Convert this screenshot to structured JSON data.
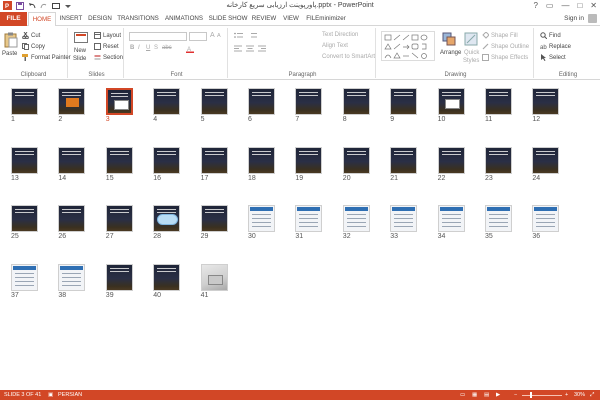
{
  "titlebar": {
    "title": "پاورپوینت ارزیابی سریع کارخانه.pptx - PowerPoint",
    "help": "?",
    "minimize": "—",
    "maximize": "□",
    "close": "✕"
  },
  "tabs": {
    "file": "FILE",
    "items": [
      "HOME",
      "INSERT",
      "DESIGN",
      "TRANSITIONS",
      "ANIMATIONS",
      "SLIDE SHOW",
      "REVIEW",
      "VIEW",
      "FILEminimizer"
    ],
    "active": "HOME",
    "signin": "Sign in"
  },
  "ribbon": {
    "clipboard": {
      "label": "Clipboard",
      "paste": "Paste",
      "cut": "Cut",
      "copy": "Copy",
      "format_painter": "Format Painter"
    },
    "slides": {
      "label": "Slides",
      "new_slide": "New",
      "new_slide2": "Slide",
      "layout": "Layout",
      "reset": "Reset",
      "section": "Section"
    },
    "font": {
      "label": "Font",
      "bold": "B",
      "italic": "I",
      "underline": "U",
      "shadow": "S",
      "strike": "abc",
      "size_up": "A",
      "size_down": "A"
    },
    "paragraph": {
      "label": "Paragraph",
      "text_direction": "Text Direction",
      "align_text": "Align Text",
      "convert_smartart": "Convert to SmartArt"
    },
    "drawing": {
      "label": "Drawing",
      "arrange": "Arrange",
      "quick_styles": "Quick",
      "quick_styles2": "Styles",
      "shape_fill": "Shape Fill",
      "shape_outline": "Shape Outline",
      "shape_effects": "Shape Effects"
    },
    "editing": {
      "label": "Editing",
      "find": "Find",
      "replace": "Replace",
      "select": "Select"
    }
  },
  "slides": [
    {
      "n": "1",
      "style": "dark"
    },
    {
      "n": "2",
      "style": "dark-orange"
    },
    {
      "n": "3",
      "style": "dark-diagram",
      "selected": true
    },
    {
      "n": "4",
      "style": "dark"
    },
    {
      "n": "5",
      "style": "dark"
    },
    {
      "n": "6",
      "style": "dark"
    },
    {
      "n": "7",
      "style": "dark"
    },
    {
      "n": "8",
      "style": "dark"
    },
    {
      "n": "9",
      "style": "dark"
    },
    {
      "n": "10",
      "style": "dark-diagram"
    },
    {
      "n": "11",
      "style": "dark"
    },
    {
      "n": "12",
      "style": "dark"
    },
    {
      "n": "13",
      "style": "dark"
    },
    {
      "n": "14",
      "style": "dark"
    },
    {
      "n": "15",
      "style": "dark"
    },
    {
      "n": "16",
      "style": "dark"
    },
    {
      "n": "17",
      "style": "dark"
    },
    {
      "n": "18",
      "style": "dark"
    },
    {
      "n": "19",
      "style": "dark"
    },
    {
      "n": "20",
      "style": "dark"
    },
    {
      "n": "21",
      "style": "dark"
    },
    {
      "n": "22",
      "style": "dark"
    },
    {
      "n": "23",
      "style": "dark"
    },
    {
      "n": "24",
      "style": "dark"
    },
    {
      "n": "25",
      "style": "dark"
    },
    {
      "n": "26",
      "style": "dark"
    },
    {
      "n": "27",
      "style": "dark"
    },
    {
      "n": "28",
      "style": "cloud"
    },
    {
      "n": "29",
      "style": "dark"
    },
    {
      "n": "30",
      "style": "light"
    },
    {
      "n": "31",
      "style": "light"
    },
    {
      "n": "32",
      "style": "light"
    },
    {
      "n": "33",
      "style": "light"
    },
    {
      "n": "34",
      "style": "light"
    },
    {
      "n": "35",
      "style": "light"
    },
    {
      "n": "36",
      "style": "light"
    },
    {
      "n": "37",
      "style": "light"
    },
    {
      "n": "38",
      "style": "light"
    },
    {
      "n": "39",
      "style": "dark"
    },
    {
      "n": "40",
      "style": "dark"
    },
    {
      "n": "41",
      "style": "photo"
    }
  ],
  "statusbar": {
    "slide_info": "SLIDE 3 OF 41",
    "language": "PERSIAN",
    "zoom_minus": "−",
    "zoom_plus": "+",
    "zoom": "30%"
  },
  "colors": {
    "accent": "#d24726"
  }
}
